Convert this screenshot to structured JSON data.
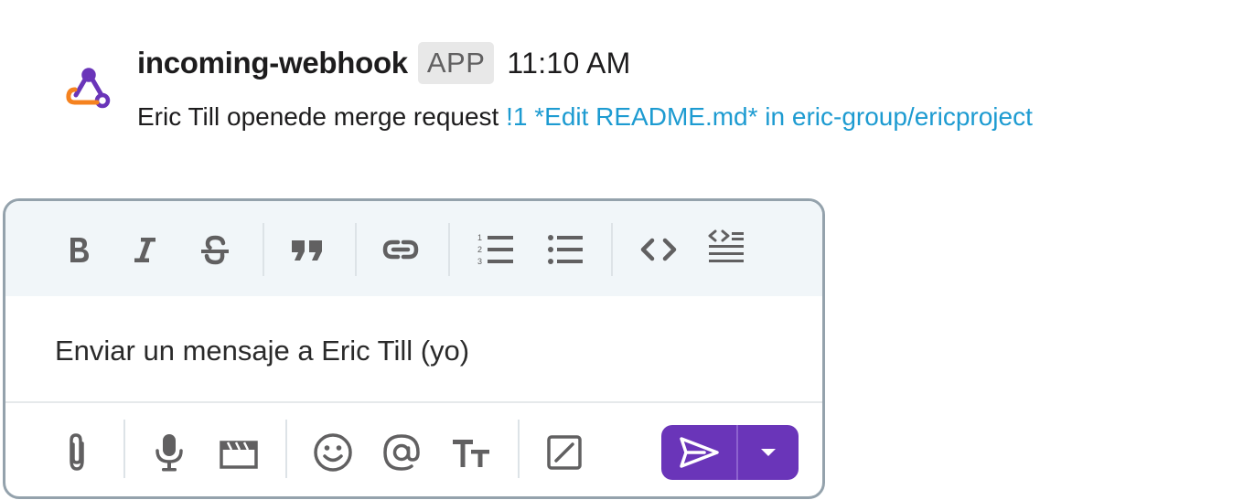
{
  "message": {
    "sender": "incoming-webhook",
    "badge": "APP",
    "time": "11:10 AM",
    "text": "Eric Till openede merge request ",
    "link_text": "!1 *Edit README.md* in eric-group/ericproject"
  },
  "composer": {
    "placeholder": "Enviar un mensaje a Eric Till (yo)",
    "value": "",
    "format_tools": [
      "bold",
      "italic",
      "strikethrough",
      "quote",
      "link",
      "ordered-list",
      "bulleted-list",
      "code",
      "code-block"
    ],
    "actions": [
      "attach",
      "microphone",
      "video",
      "emoji",
      "mention",
      "text-formatting",
      "shortcuts"
    ]
  },
  "colors": {
    "link": "#1d9bd1",
    "send_button": "#6a35b9",
    "toolbar_bg": "#f1f6f9",
    "composer_border": "#94a2ac",
    "icon": "#616061"
  }
}
